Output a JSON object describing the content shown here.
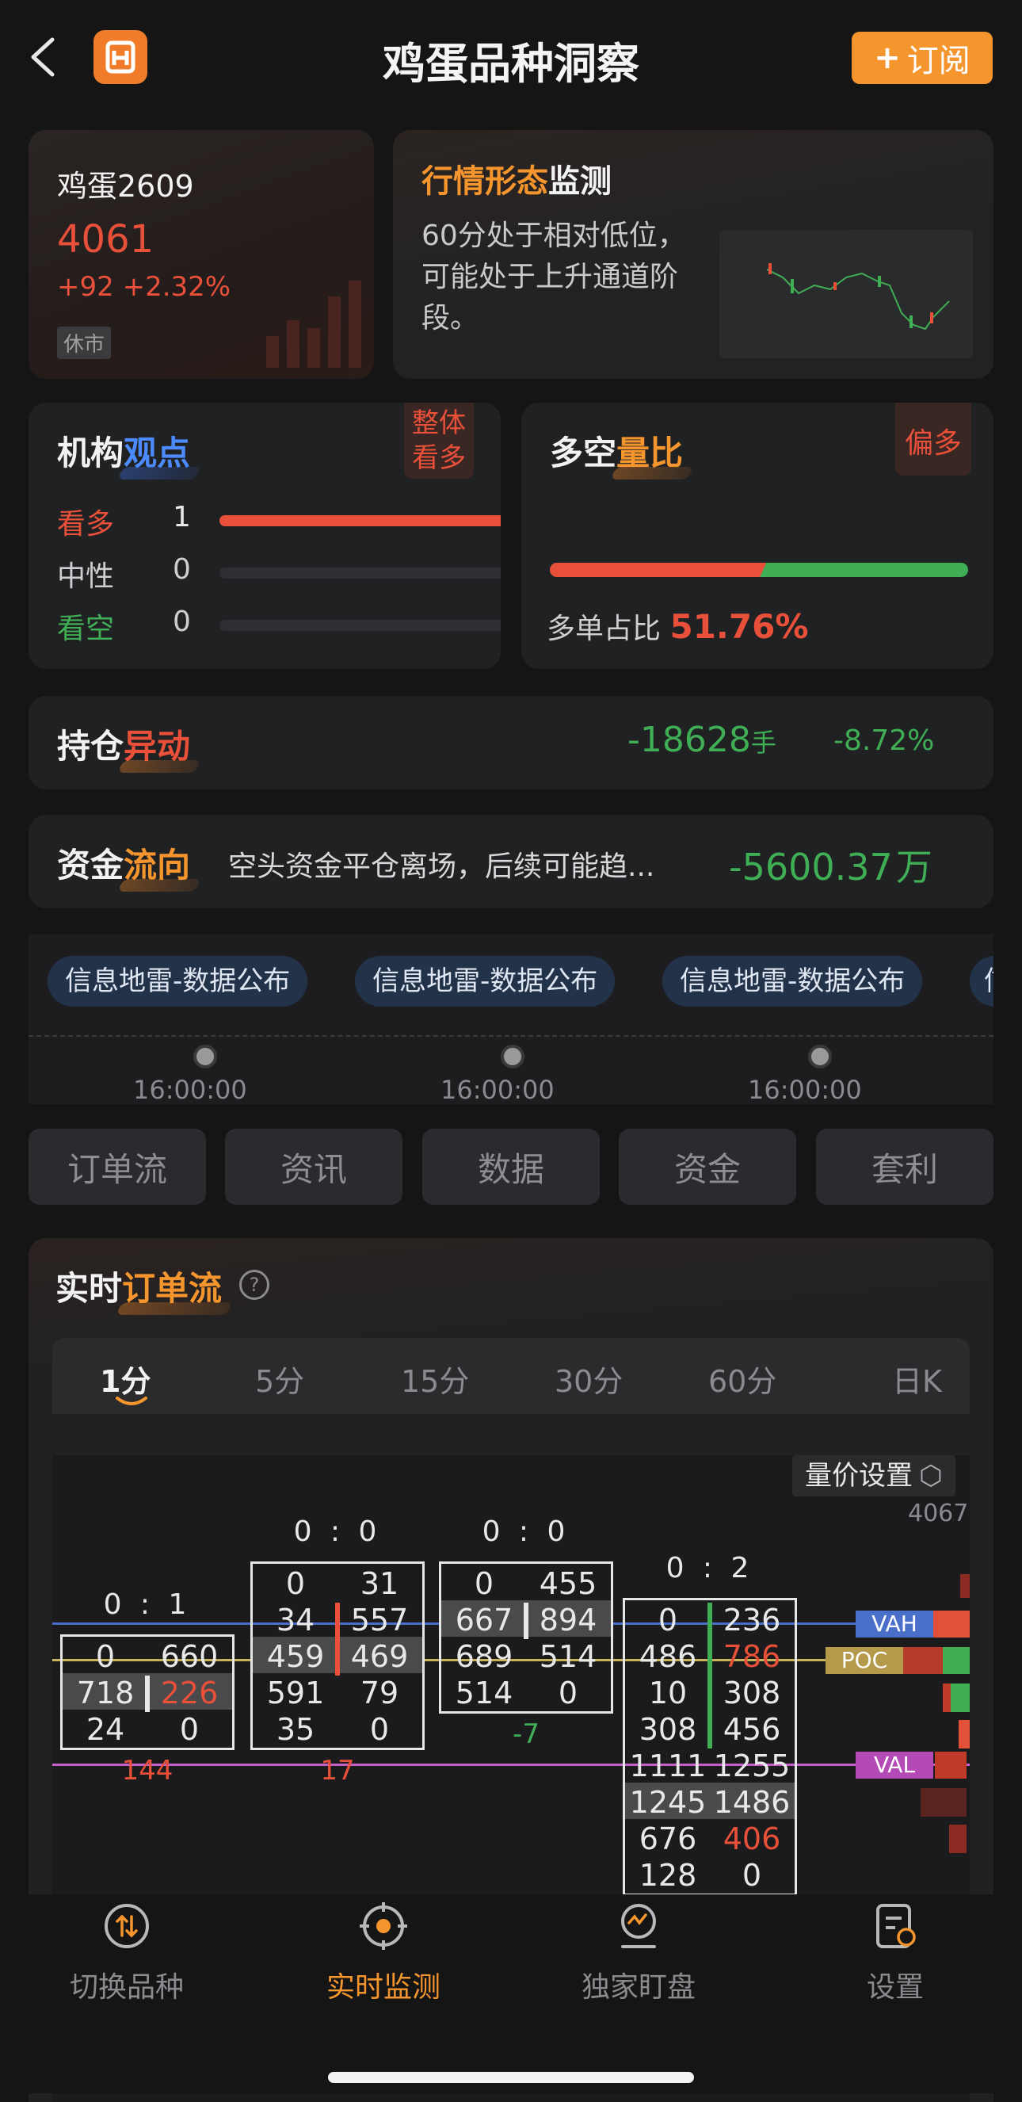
{
  "header": {
    "title": "鸡蛋品种洞察",
    "subscribe": "订阅",
    "subscribe_plus": "+"
  },
  "quote": {
    "name": "鸡蛋2609",
    "price": "4061",
    "change": "+92",
    "change_pct": "+2.32%",
    "status": "休市"
  },
  "pattern": {
    "title_a": "行情形态",
    "title_b": "监测",
    "text": "60分处于相对低位，可能处于上升通道阶段。"
  },
  "institution": {
    "title_a": "机构",
    "title_b": "观点",
    "badge_l1": "整体",
    "badge_l2": "看多",
    "rows": [
      {
        "label": "看多",
        "count": "1",
        "ratio": 1.0
      },
      {
        "label": "中性",
        "count": "0",
        "ratio": 0
      },
      {
        "label": "看空",
        "count": "0",
        "ratio": 0
      }
    ]
  },
  "longshort": {
    "title_a": "多空",
    "title_b": "量比",
    "badge": "偏多",
    "label": "多单占比",
    "value": "51.76%",
    "ratio": 0.5176
  },
  "position": {
    "title_a": "持仓",
    "title_b": "异动",
    "value": "-18628",
    "unit": "手",
    "pct": "-8.72%"
  },
  "fund": {
    "title_a": "资金",
    "title_b": "流向",
    "text": "空头资金平仓离场，后续可能趋...",
    "value": "-5600.37",
    "unit": "万"
  },
  "timeline": {
    "items": [
      {
        "tag": "信息地雷-数据公布",
        "time": "16:00:00"
      },
      {
        "tag": "信息地雷-数据公布",
        "time": "16:00:00"
      },
      {
        "tag": "信息地雷-数据公布",
        "time": "16:00:00"
      }
    ],
    "more_tag": "信"
  },
  "tabs": [
    "订单流",
    "资讯",
    "数据",
    "资金",
    "套利"
  ],
  "orderflow": {
    "title_a": "实时",
    "title_b": "订单流",
    "help": "?",
    "periods": [
      "1分",
      "5分",
      "15分",
      "30分",
      "60分",
      "日K"
    ],
    "settings": "量价设置",
    "price_top": "4067",
    "markers": [
      "VAH",
      "POC",
      "VAL"
    ],
    "bars": [
      {
        "ratio": "0 : 1",
        "rows": [
          [
            "0",
            "660"
          ],
          [
            "718",
            "226"
          ],
          [
            "24",
            "0"
          ]
        ],
        "delta": "144"
      },
      {
        "ratio": "0 : 0",
        "rows": [
          [
            "0",
            "31"
          ],
          [
            "34",
            "557"
          ],
          [
            "459",
            "469"
          ],
          [
            "591",
            "79"
          ],
          [
            "35",
            "0"
          ]
        ],
        "delta": "17"
      },
      {
        "ratio": "0 : 0",
        "rows": [
          [
            "0",
            "455"
          ],
          [
            "667",
            "894"
          ],
          [
            "689",
            "514"
          ],
          [
            "514",
            "0"
          ]
        ],
        "delta": "-7"
      },
      {
        "ratio": "0 : 2",
        "rows": [
          [
            "0",
            "236"
          ],
          [
            "486",
            "786"
          ],
          [
            "10",
            "308"
          ],
          [
            "308",
            "456"
          ],
          [
            "1111",
            "1255"
          ],
          [
            "1245",
            "1486"
          ],
          [
            "676",
            "406"
          ],
          [
            "128",
            "0"
          ]
        ],
        "delta": ""
      }
    ]
  },
  "nav": [
    {
      "label": "切换品种",
      "icon": "switch-icon"
    },
    {
      "label": "实时监测",
      "icon": "monitor-icon"
    },
    {
      "label": "独家盯盘",
      "icon": "watch-icon"
    },
    {
      "label": "设置",
      "icon": "settings-icon"
    }
  ],
  "colors": {
    "accent": "#f5952e",
    "red": "#e8503a",
    "green": "#3fae55",
    "bg": "#151516",
    "card": "#202123"
  }
}
